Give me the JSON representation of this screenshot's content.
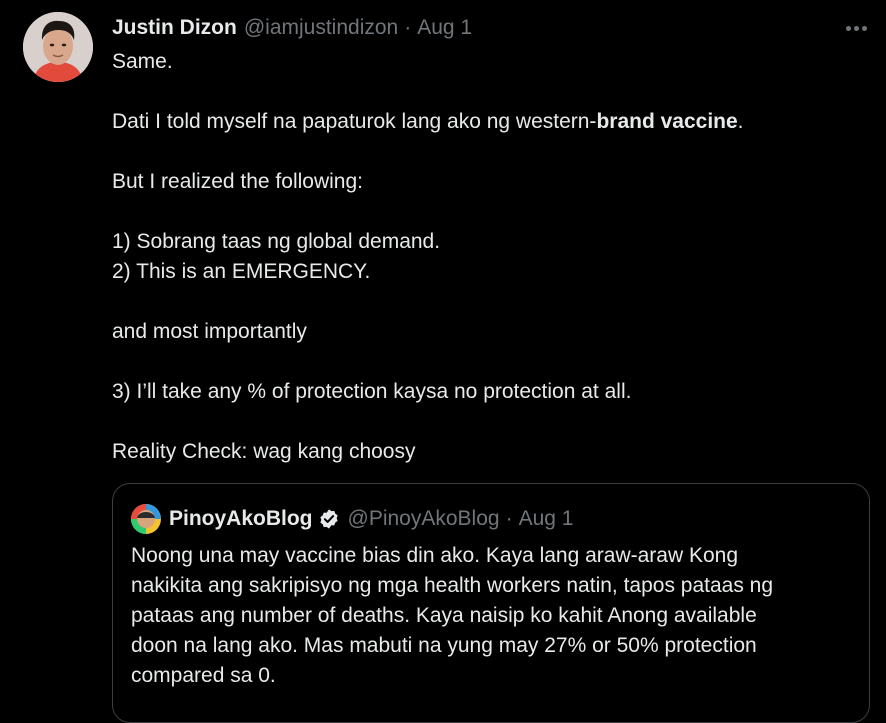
{
  "tweet": {
    "author_name": "Justin Dizon",
    "author_handle": "@iamjustindizon",
    "separator": "·",
    "time": "Aug 1",
    "lines": {
      "l1": "Same.",
      "l2_pre": "Dati I told myself na papaturok lang ako ng western-",
      "l2_bold": "brand vaccine",
      "l2_post": ".",
      "l3": "But I realized the following:",
      "l4": "1) Sobrang taas ng global demand.",
      "l5": "2) This is an EMERGENCY.",
      "l6": "and most importantly",
      "l7": "3) I’ll take any % of protection kaysa no protection at all.",
      "l8": "Reality Check: wag kang choosy"
    }
  },
  "quoted": {
    "author_name": "PinoyAkoBlog",
    "author_handle": "@PinoyAkoBlog",
    "separator": "·",
    "time": "Aug 1",
    "lines": [
      "Noong una may vaccine bias din ako. Kaya lang araw-araw Kong",
      "nakikita ang sakripisyo ng mga health workers natin, tapos pataas ng",
      "pataas ang number of deaths. Kaya naisip ko kahit Anong available",
      "doon na lang ako. Mas mabuti na yung may 27% or 50% protection",
      "compared sa 0."
    ]
  },
  "icons": {
    "more": "more-dots-icon",
    "verified": "verified-badge-icon"
  },
  "colors": {
    "background": "#000000",
    "text": "#e7e9ea",
    "muted": "#71767b",
    "border": "#3a3d41"
  }
}
